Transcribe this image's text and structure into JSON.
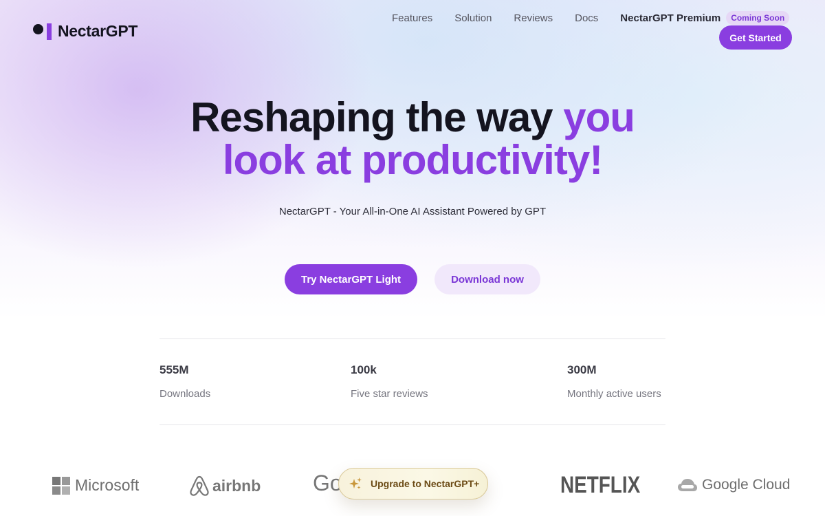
{
  "brand": {
    "name": "NectarGPT"
  },
  "nav": {
    "items": [
      "Features",
      "Solution",
      "Reviews",
      "Docs"
    ],
    "premium_label": "NectarGPT Premium",
    "premium_badge": "Coming Soon",
    "cta_label": "Get Started"
  },
  "hero": {
    "title_dark": "Reshaping the way ",
    "title_accent_1": "you",
    "title_accent_2": "look at productivity!",
    "subtitle": "NectarGPT - Your All-in-One AI Assistant Powered by GPT",
    "primary_button": "Try NectarGPT Light",
    "secondary_button": "Download now"
  },
  "stats": [
    {
      "value": "555M",
      "label": "Downloads"
    },
    {
      "value": "100k",
      "label": "Five star reviews"
    },
    {
      "value": "300M",
      "label": "Monthly active users"
    }
  ],
  "logos": {
    "microsoft": "Microsoft",
    "airbnb": "airbnb",
    "google_partial": "Go",
    "netflix": "NETFLIX",
    "google_cloud": "Google Cloud"
  },
  "upgrade": {
    "label": "Upgrade to NectarGPT+",
    "icon": "sparkles-icon"
  },
  "colors": {
    "accent": "#8a3ee0",
    "accent_soft": "#f1e8fb",
    "badge_bg": "#e6d8f6",
    "text_dark": "#14141f",
    "upgrade_text": "#6b4a14"
  }
}
